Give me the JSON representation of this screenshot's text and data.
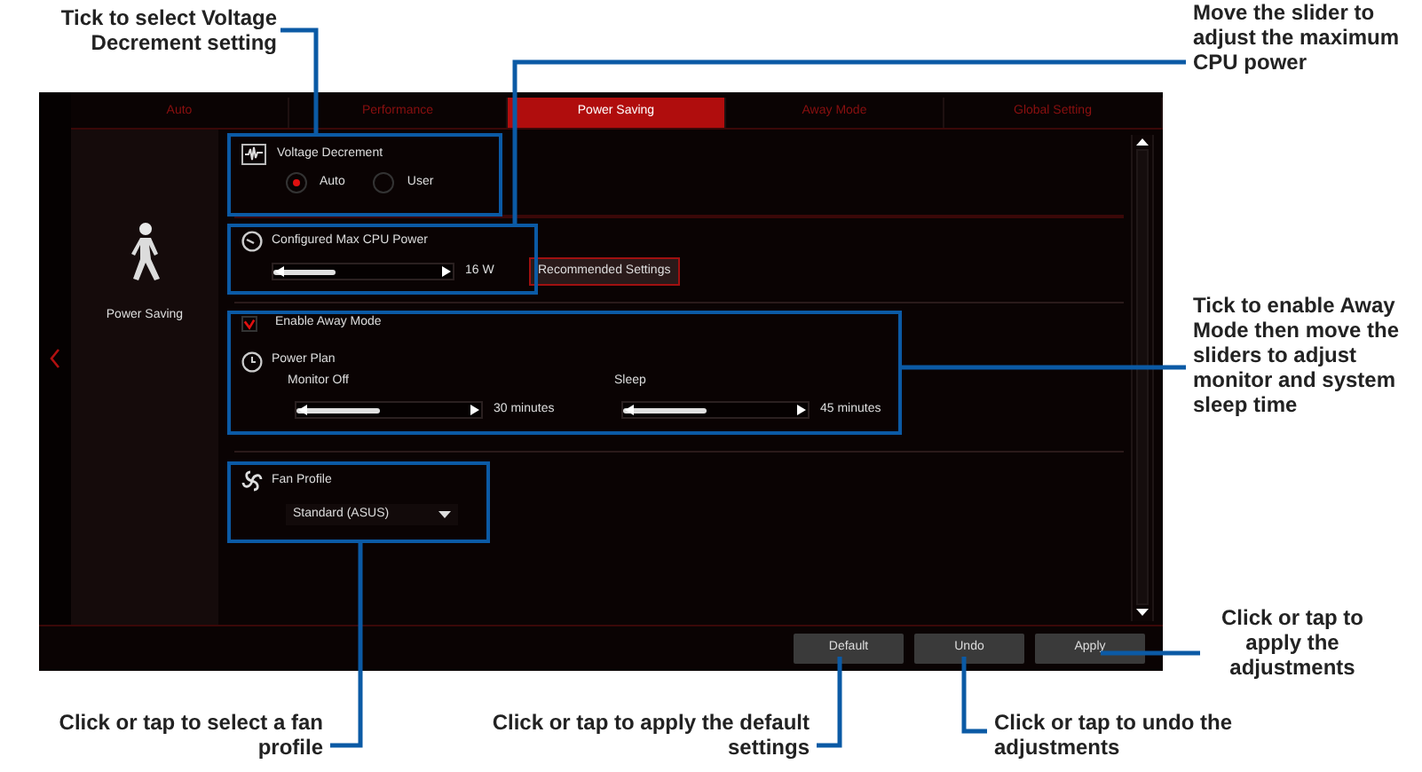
{
  "tabs": [
    {
      "label": "Auto",
      "selected": false
    },
    {
      "label": "Performance",
      "selected": false
    },
    {
      "label": "Power Saving",
      "selected": true
    },
    {
      "label": "Away Mode",
      "selected": false
    },
    {
      "label": "Global Setting",
      "selected": false
    }
  ],
  "sidebar": {
    "label": "Power Saving"
  },
  "voltage_decrement": {
    "title": "Voltage Decrement",
    "options": [
      {
        "label": "Auto",
        "selected": true
      },
      {
        "label": "User",
        "selected": false
      }
    ]
  },
  "max_cpu_power": {
    "title": "Configured Max CPU Power",
    "level": 0.35,
    "reading": "16 W",
    "button": "Recommended Settings"
  },
  "away_mode": {
    "label": "Enable Away Mode",
    "checked": true,
    "power_plan": "Power Plan",
    "sliders": [
      {
        "name": "Monitor Off",
        "level": 0.45,
        "reading": "30 minutes"
      },
      {
        "name": "Sleep",
        "level": 0.45,
        "reading": "45 minutes"
      }
    ]
  },
  "fan_profile": {
    "title": "Fan Profile",
    "value": "Standard (ASUS)"
  },
  "buttons": [
    "Default",
    "Undo",
    "Apply"
  ],
  "callouts": [
    "Tick to select Voltage Decrement setting",
    "Move the slider to adjust the maximum CPU power",
    "Tick to enable Away Mode then move the sliders to adjust monitor and system sleep time",
    "Click or tap to apply the adjustments",
    "Click or tap to select a fan profile",
    "Click or tap to apply the default settings",
    "Click or tap to undo the adjustments"
  ]
}
